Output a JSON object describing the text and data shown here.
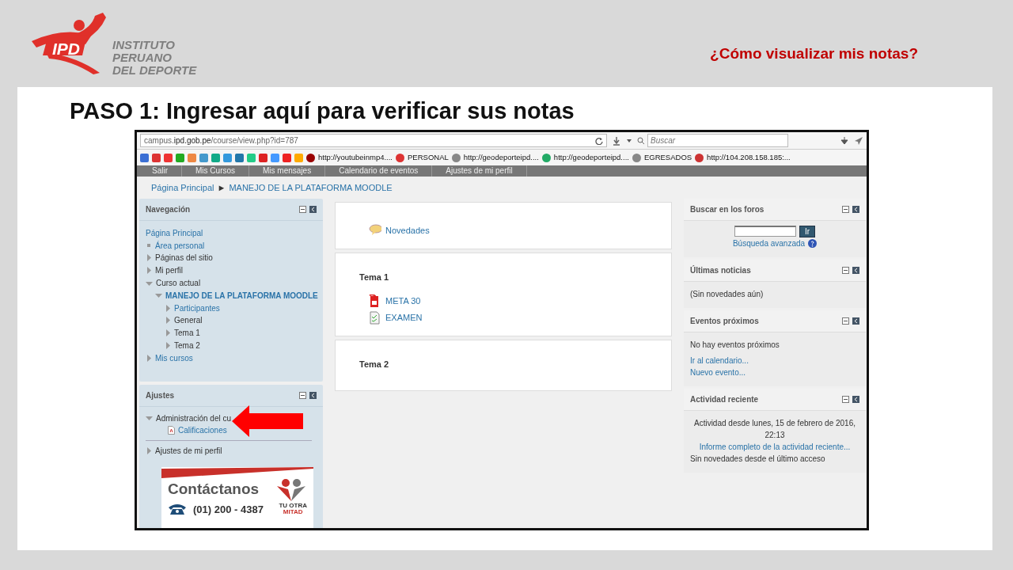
{
  "slide": {
    "logo_mark": "IPD",
    "logo_lines": [
      "INSTITUTO",
      "PERUANO",
      "DEL DEPORTE"
    ],
    "header_title": "¿Cómo visualizar mis notas?",
    "step_title": "PASO 1: Ingresar aquí para verificar sus notas"
  },
  "browser": {
    "url": "campus.**ipd.gob.pe**/course/view.php?id=787",
    "search_placeholder": "Buscar",
    "bookmarks": [
      {
        "label": "http://youtubeinmp4...."
      },
      {
        "label": "PERSONAL"
      },
      {
        "label": "http://geodeporteipd...."
      },
      {
        "label": "http://geodeporteipd...."
      },
      {
        "label": "EGRESADOS"
      },
      {
        "label": "http://104.208.158.185:..."
      }
    ]
  },
  "menu": [
    "Salir",
    "Mis Cursos",
    "Mis mensajes",
    "Calendario de eventos",
    "Ajustes de mi perfil"
  ],
  "breadcrumb": {
    "items": [
      "Página Principal",
      "MANEJO DE LA PLATAFORMA MOODLE"
    ],
    "separator": "►"
  },
  "navigation": {
    "title": "Navegación",
    "items": [
      {
        "label": "Página Principal",
        "kind": "root",
        "link": true
      },
      {
        "label": "Área personal",
        "kind": "leaf",
        "link": true
      },
      {
        "label": "Páginas del sitio",
        "kind": "branch",
        "expanded": false,
        "link": false
      },
      {
        "label": "Mi perfil",
        "kind": "branch",
        "expanded": false,
        "link": false
      },
      {
        "label": "Curso actual",
        "kind": "branch",
        "expanded": true,
        "link": false,
        "children": [
          {
            "label": "MANEJO DE LA PLATAFORMA MOODLE",
            "kind": "branch",
            "expanded": true,
            "link": true,
            "current": true,
            "children": [
              {
                "label": "Participantes",
                "kind": "branch",
                "expanded": false,
                "link": true
              },
              {
                "label": "General",
                "kind": "branch",
                "expanded": false,
                "link": false
              },
              {
                "label": "Tema 1",
                "kind": "branch",
                "expanded": false,
                "link": false
              },
              {
                "label": "Tema 2",
                "kind": "branch",
                "expanded": false,
                "link": false
              }
            ]
          }
        ]
      },
      {
        "label": "Mis cursos",
        "kind": "branch",
        "expanded": false,
        "link": true
      }
    ]
  },
  "settings": {
    "title": "Ajustes",
    "items": [
      {
        "label": "Administración del cu",
        "kind": "branch",
        "expanded": true,
        "link": false,
        "children": [
          {
            "label": "Calificaciones",
            "kind": "file",
            "link": true
          }
        ]
      },
      {
        "label": "Ajustes de mi perfil",
        "kind": "branch",
        "expanded": false,
        "link": false
      }
    ]
  },
  "contact": {
    "title": "Contáctanos",
    "phone": "(01) 200 - 4387",
    "tagline": [
      "TU OTRA",
      "MITAD"
    ]
  },
  "sections": [
    {
      "activities": [
        {
          "kind": "forum",
          "label": "Novedades"
        }
      ]
    },
    {
      "title": "Tema 1",
      "activities": [
        {
          "kind": "pdf",
          "label": "META 30"
        },
        {
          "kind": "quiz",
          "label": "EXAMEN"
        }
      ]
    },
    {
      "title": "Tema 2"
    }
  ],
  "blocks": [
    {
      "title": "Buscar en los foros",
      "kind": "search",
      "button": "Ir",
      "link": "Búsqueda avanzada"
    },
    {
      "title": "Últimas noticias",
      "kind": "list",
      "lines": [
        {
          "kind": "text",
          "text": "(Sin novedades aún)"
        }
      ]
    },
    {
      "title": "Eventos próximos",
      "kind": "list",
      "lines": [
        {
          "kind": "text",
          "text": "No hay eventos próximos"
        },
        {
          "kind": "link",
          "text": "Ir al calendario..."
        },
        {
          "kind": "link",
          "text": "Nuevo evento..."
        }
      ]
    },
    {
      "title": "Actividad reciente",
      "kind": "activity",
      "lines": [
        {
          "kind": "text",
          "text": "Actividad desde lunes, 15 de febrero de 2016, 22:13"
        },
        {
          "kind": "link",
          "text": "Informe completo de la actividad reciente..."
        },
        {
          "kind": "plain",
          "text": "Sin novedades desde el último acceso"
        }
      ]
    }
  ]
}
